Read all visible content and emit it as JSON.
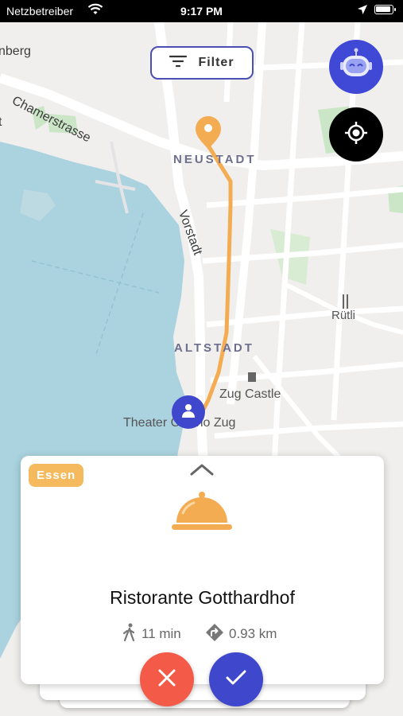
{
  "status_bar": {
    "carrier": "Netzbetreiber",
    "time": "9:17 PM",
    "wifi_icon": "wifi-icon",
    "location_icon": "location-arrow-icon",
    "battery_icon": "battery-icon"
  },
  "map": {
    "labels": {
      "place_top_left": "nberg",
      "street_1": "Chamerstrasse",
      "street_2": "Vorstadt",
      "district_1": "NEUSTADT",
      "district_2": "ALTSTADT",
      "poi_1": "Rütli",
      "poi_2": "Zug Castle",
      "poi_3": "Theater Casino Zug",
      "edge_letter": "t"
    },
    "colors": {
      "water": "#aad3df",
      "land": "#f0efed",
      "park": "#cbe6c6",
      "route": "#f4ac52",
      "road": "#ffffff"
    }
  },
  "filter_button": {
    "label": "Filter",
    "icon": "filter-lines-icon"
  },
  "assistant_button": {
    "icon": "robot-icon"
  },
  "locate_button": {
    "icon": "crosshair-icon"
  },
  "card": {
    "category": "Essen",
    "category_color": "#f5b95e",
    "expand_icon": "chevron-up-icon",
    "image_icon": "cloche-icon",
    "name": "Ristorante Gotthardhof",
    "walk_time": "11 min",
    "walk_icon": "walking-icon",
    "distance": "0.93 km",
    "distance_icon": "directions-icon"
  },
  "actions": {
    "reject_icon": "close-icon",
    "reject_color": "#f35a48",
    "accept_icon": "check-icon",
    "accept_color": "#3f47cc"
  }
}
